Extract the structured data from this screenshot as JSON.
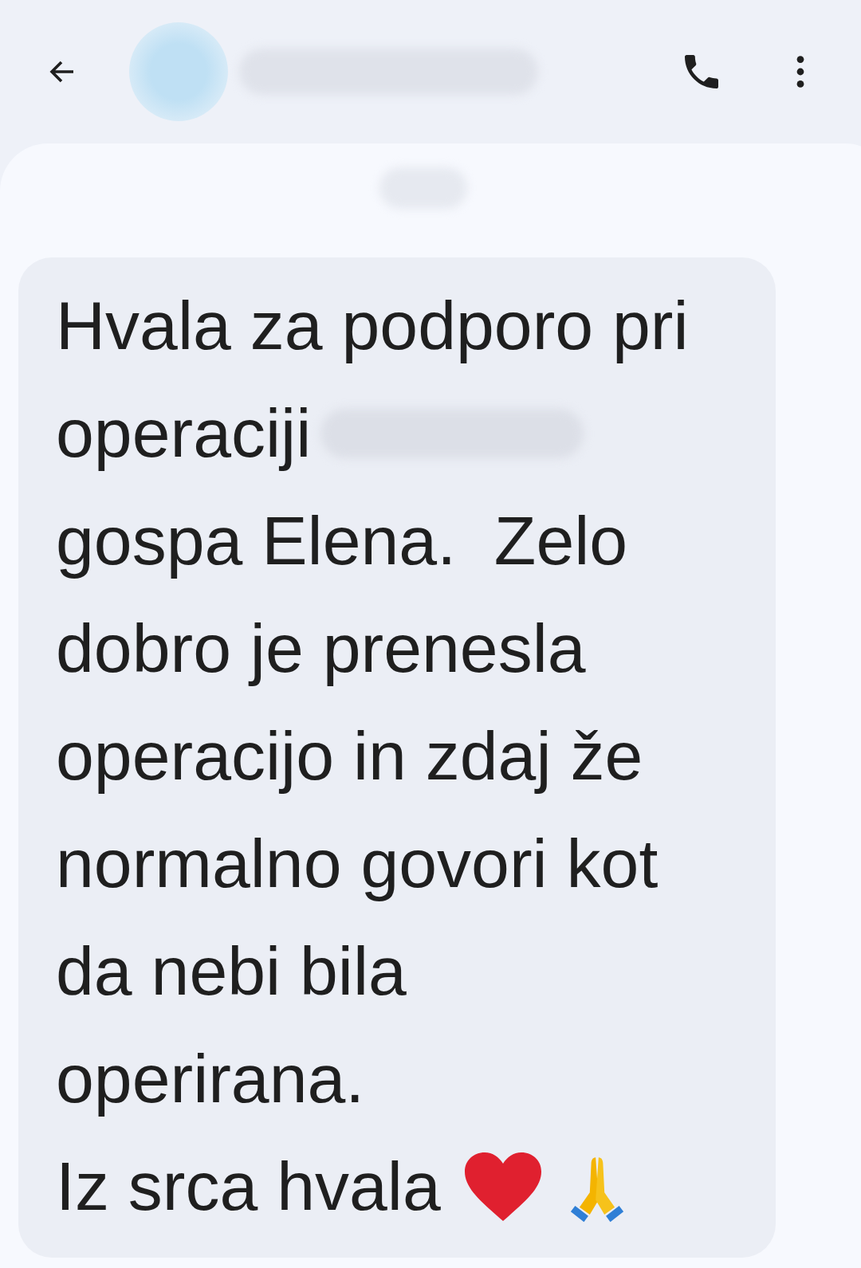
{
  "header": {
    "contact_redacted": true
  },
  "conversation": {
    "timestamp_redacted": true
  },
  "message": {
    "lines": [
      {
        "text": "Hvala za podporo pri",
        "redacted_after": false
      },
      {
        "text": "operaciji",
        "redacted_after": true
      },
      {
        "text": "gospa Elena.  Zelo",
        "redacted_after": false
      },
      {
        "text": "dobro je prenesla",
        "redacted_after": false
      },
      {
        "text": "operacijo in zdaj že",
        "redacted_after": false
      },
      {
        "text": "normalno govori kot",
        "redacted_after": false
      },
      {
        "text": "da nebi bila",
        "redacted_after": false
      },
      {
        "text": "operirana.",
        "redacted_after": false
      },
      {
        "text": "Iz srca hvala",
        "redacted_after": false
      }
    ]
  }
}
